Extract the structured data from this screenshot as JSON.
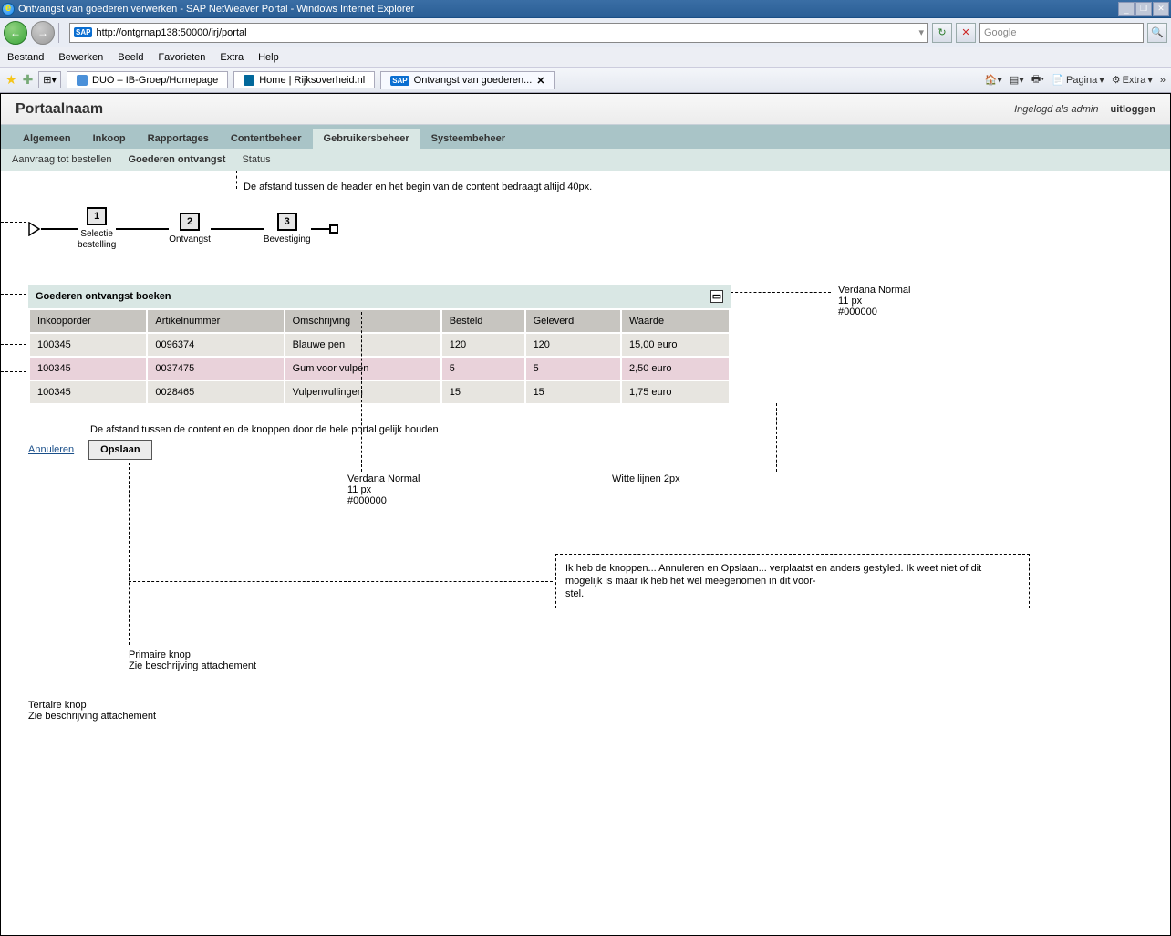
{
  "window": {
    "title": "Ontvangst van goederen verwerken - SAP NetWeaver Portal - Windows Internet Explorer",
    "url": "http://ontgrnap138:50000/irj/portal",
    "search_placeholder": "Google"
  },
  "menubar": [
    "Bestand",
    "Bewerken",
    "Beeld",
    "Favorieten",
    "Extra",
    "Help"
  ],
  "browser_tabs": [
    {
      "label": "DUO – IB-Groep/Homepage",
      "active": false
    },
    {
      "label": "Home | Rijksoverheid.nl",
      "active": false
    },
    {
      "label": "Ontvangst van goederen...",
      "active": true
    }
  ],
  "toolbar_right": {
    "home": "",
    "rss": "",
    "print": "",
    "pagina": "Pagina",
    "extra": "Extra"
  },
  "portal": {
    "title": "Portaalnaam",
    "logged_in_as": "Ingelogd als admin",
    "logout": "uitloggen"
  },
  "mainnav": [
    {
      "label": "Algemeen"
    },
    {
      "label": "Inkoop"
    },
    {
      "label": "Rapportages"
    },
    {
      "label": "Contentbeheer"
    },
    {
      "label": "Gebruikersbeheer",
      "active": true
    },
    {
      "label": "Systeembeheer"
    }
  ],
  "subnav": [
    {
      "label": "Aanvraag tot bestellen"
    },
    {
      "label": "Goederen ontvangst",
      "active": true
    },
    {
      "label": "Status"
    }
  ],
  "wizard": [
    {
      "num": "1",
      "label": "Selectie\nbestelling"
    },
    {
      "num": "2",
      "label": "Ontvangst"
    },
    {
      "num": "3",
      "label": "Bevestiging"
    }
  ],
  "annotations": {
    "header_spacing": "De afstand tussen de header en het begin van de content bedraagt altijd 40px.",
    "font_spec_right": "Verdana Normal\n11 px\n#000000",
    "content_buttons_spacing": "De afstand tussen de content en de knoppen door de hele portal gelijk houden",
    "font_spec_mid": "Verdana Normal\n11 px\n#000000",
    "white_lines": "Witte lijnen 2px",
    "primary_btn_note": "Primaire knop\nZie beschrijving attachement",
    "tertiary_btn_note": "Tertaire knop\nZie beschrijving attachement",
    "infobox": "Ik heb de knoppen... Annuleren en Opslaan... verplaatst en anders gestyled. Ik weet niet of dit mogelijk is maar ik heb het wel meegenomen in dit voor-\nstel."
  },
  "panel": {
    "title": "Goederen ontvangst boeken",
    "columns": [
      "Inkooporder",
      "Artikelnummer",
      "Omschrijving",
      "Besteld",
      "Geleverd",
      "Waarde"
    ],
    "rows": [
      [
        "100345",
        "0096374",
        "Blauwe pen",
        "120",
        "120",
        "15,00 euro"
      ],
      [
        "100345",
        "0037475",
        "Gum voor vulpen",
        "5",
        "5",
        "2,50 euro"
      ],
      [
        "100345",
        "0028465",
        "Vulpenvullingen",
        "15",
        "15",
        "1,75 euro"
      ]
    ]
  },
  "actions": {
    "cancel": "Annuleren",
    "save": "Opslaan"
  }
}
